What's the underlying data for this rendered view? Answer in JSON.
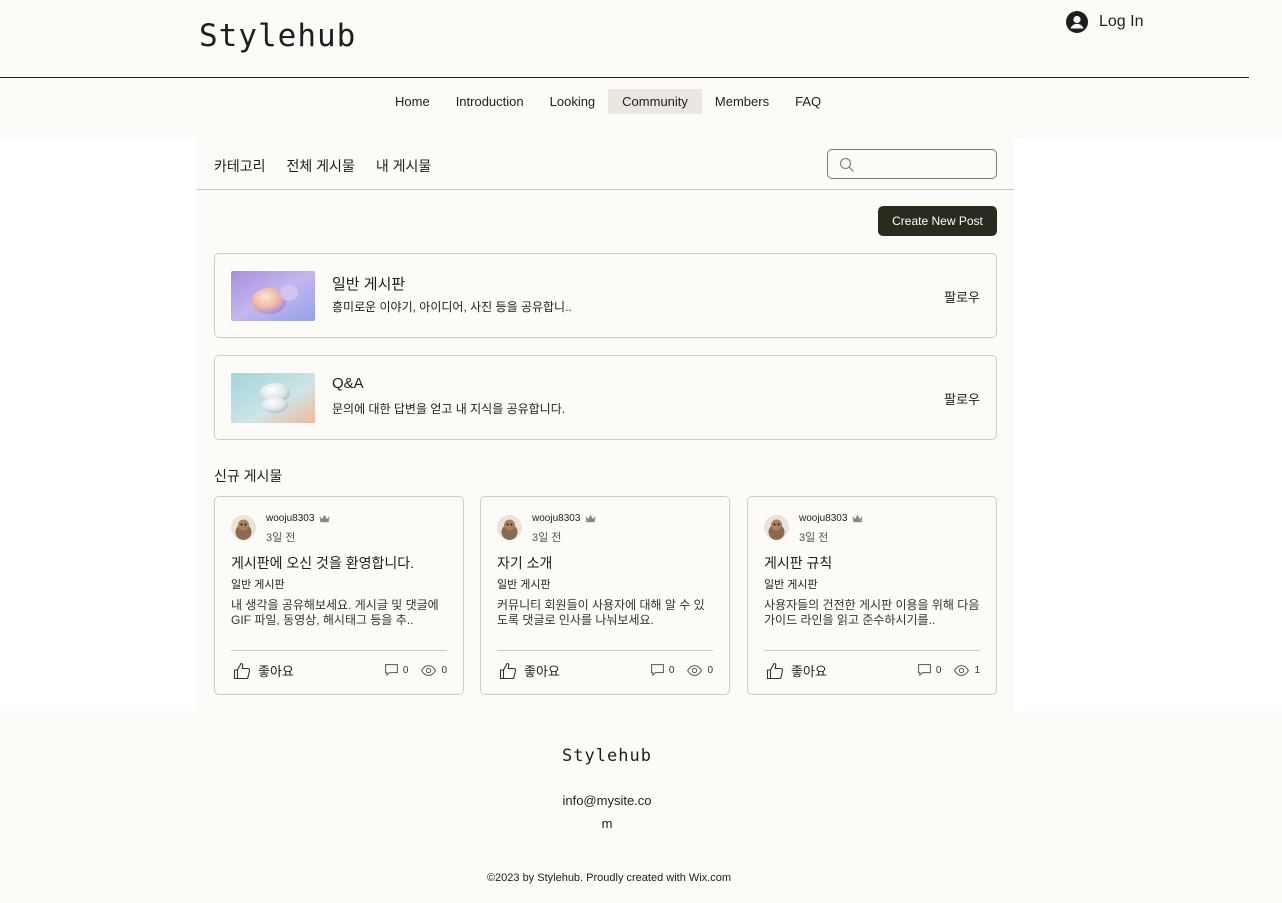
{
  "header": {
    "logo": "Stylehub",
    "login_label": "Log In"
  },
  "nav": {
    "items": [
      "Home",
      "Introduction",
      "Looking",
      "Community",
      "Members",
      "FAQ"
    ],
    "active": "Community"
  },
  "forum": {
    "tabs": [
      "카테고리",
      "전체 게시물",
      "내 게시물"
    ],
    "search_placeholder": "",
    "create_post_label": "Create New Post",
    "categories": [
      {
        "title": "일반 게시판",
        "description": "흥미로운 이야기, 아이디어, 사진 등을 공유합니..",
        "follow_label": "팔로우"
      },
      {
        "title": "Q&A",
        "description": "문의에 대한 답변을 얻고 내 지식을 공유합니다.",
        "follow_label": "팔로우"
      }
    ],
    "recent_title": "신규 게시물",
    "posts": [
      {
        "author": "wooju8303",
        "time": "3일 전",
        "title": "게시판에 오신 것을 환영합니다.",
        "category": "일반 게시판",
        "excerpt": "내 생각을 공유해보세요. 게시글 및 댓글에 GIF 파일, 동영상, 해시태그 등을 추..",
        "like_label": "좋아요",
        "comments": "0",
        "views": "0"
      },
      {
        "author": "wooju8303",
        "time": "3일 전",
        "title": "자기 소개",
        "category": "일반 게시판",
        "excerpt": "커뮤니티 회원들이 사용자에 대해 알 수 있도록 댓글로 인사를 나눠보세요.",
        "like_label": "좋아요",
        "comments": "0",
        "views": "0"
      },
      {
        "author": "wooju8303",
        "time": "3일 전",
        "title": "게시판 규칙",
        "category": "일반 게시판",
        "excerpt": "사용자들의 건전한 게시판 이용을 위해 다음 가이드 라인을 읽고 준수하시기를..",
        "like_label": "좋아요",
        "comments": "0",
        "views": "1"
      }
    ]
  },
  "footer": {
    "logo": "Stylehub",
    "email": "info@mysite.com",
    "copyright": "©2023 by Stylehub. Proudly created with Wix.com"
  },
  "colors": {
    "background": "#fcfbf8",
    "text": "#1e1e1e",
    "button": "#2a2b1e",
    "nav_active": "#eae6e0",
    "border": "#cfccc6"
  }
}
